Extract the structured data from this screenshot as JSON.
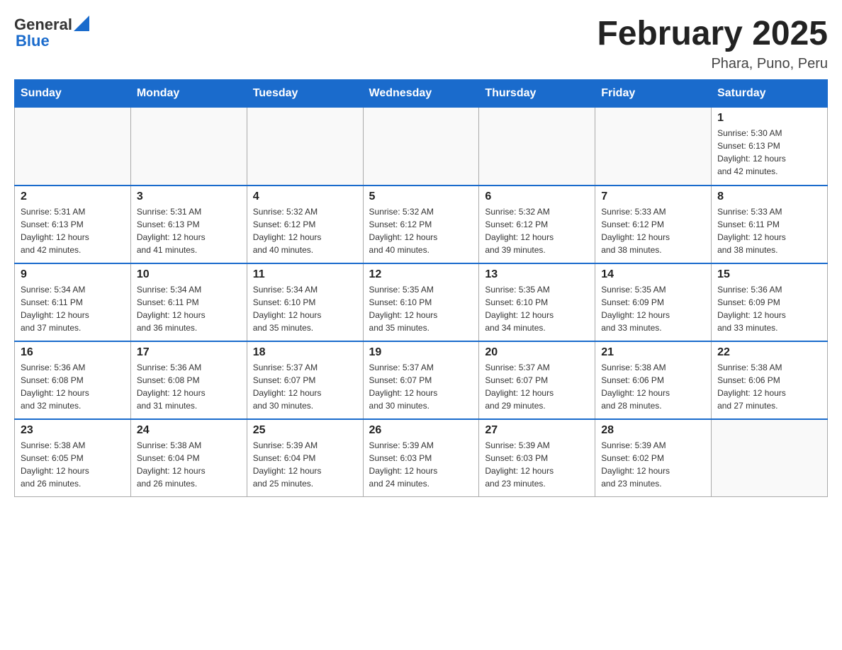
{
  "header": {
    "logo": {
      "general": "General",
      "blue": "Blue"
    },
    "title": "February 2025",
    "location": "Phara, Puno, Peru"
  },
  "days_of_week": [
    "Sunday",
    "Monday",
    "Tuesday",
    "Wednesday",
    "Thursday",
    "Friday",
    "Saturday"
  ],
  "weeks": [
    [
      {
        "day": "",
        "info": ""
      },
      {
        "day": "",
        "info": ""
      },
      {
        "day": "",
        "info": ""
      },
      {
        "day": "",
        "info": ""
      },
      {
        "day": "",
        "info": ""
      },
      {
        "day": "",
        "info": ""
      },
      {
        "day": "1",
        "info": "Sunrise: 5:30 AM\nSunset: 6:13 PM\nDaylight: 12 hours\nand 42 minutes."
      }
    ],
    [
      {
        "day": "2",
        "info": "Sunrise: 5:31 AM\nSunset: 6:13 PM\nDaylight: 12 hours\nand 42 minutes."
      },
      {
        "day": "3",
        "info": "Sunrise: 5:31 AM\nSunset: 6:13 PM\nDaylight: 12 hours\nand 41 minutes."
      },
      {
        "day": "4",
        "info": "Sunrise: 5:32 AM\nSunset: 6:12 PM\nDaylight: 12 hours\nand 40 minutes."
      },
      {
        "day": "5",
        "info": "Sunrise: 5:32 AM\nSunset: 6:12 PM\nDaylight: 12 hours\nand 40 minutes."
      },
      {
        "day": "6",
        "info": "Sunrise: 5:32 AM\nSunset: 6:12 PM\nDaylight: 12 hours\nand 39 minutes."
      },
      {
        "day": "7",
        "info": "Sunrise: 5:33 AM\nSunset: 6:12 PM\nDaylight: 12 hours\nand 38 minutes."
      },
      {
        "day": "8",
        "info": "Sunrise: 5:33 AM\nSunset: 6:11 PM\nDaylight: 12 hours\nand 38 minutes."
      }
    ],
    [
      {
        "day": "9",
        "info": "Sunrise: 5:34 AM\nSunset: 6:11 PM\nDaylight: 12 hours\nand 37 minutes."
      },
      {
        "day": "10",
        "info": "Sunrise: 5:34 AM\nSunset: 6:11 PM\nDaylight: 12 hours\nand 36 minutes."
      },
      {
        "day": "11",
        "info": "Sunrise: 5:34 AM\nSunset: 6:10 PM\nDaylight: 12 hours\nand 35 minutes."
      },
      {
        "day": "12",
        "info": "Sunrise: 5:35 AM\nSunset: 6:10 PM\nDaylight: 12 hours\nand 35 minutes."
      },
      {
        "day": "13",
        "info": "Sunrise: 5:35 AM\nSunset: 6:10 PM\nDaylight: 12 hours\nand 34 minutes."
      },
      {
        "day": "14",
        "info": "Sunrise: 5:35 AM\nSunset: 6:09 PM\nDaylight: 12 hours\nand 33 minutes."
      },
      {
        "day": "15",
        "info": "Sunrise: 5:36 AM\nSunset: 6:09 PM\nDaylight: 12 hours\nand 33 minutes."
      }
    ],
    [
      {
        "day": "16",
        "info": "Sunrise: 5:36 AM\nSunset: 6:08 PM\nDaylight: 12 hours\nand 32 minutes."
      },
      {
        "day": "17",
        "info": "Sunrise: 5:36 AM\nSunset: 6:08 PM\nDaylight: 12 hours\nand 31 minutes."
      },
      {
        "day": "18",
        "info": "Sunrise: 5:37 AM\nSunset: 6:07 PM\nDaylight: 12 hours\nand 30 minutes."
      },
      {
        "day": "19",
        "info": "Sunrise: 5:37 AM\nSunset: 6:07 PM\nDaylight: 12 hours\nand 30 minutes."
      },
      {
        "day": "20",
        "info": "Sunrise: 5:37 AM\nSunset: 6:07 PM\nDaylight: 12 hours\nand 29 minutes."
      },
      {
        "day": "21",
        "info": "Sunrise: 5:38 AM\nSunset: 6:06 PM\nDaylight: 12 hours\nand 28 minutes."
      },
      {
        "day": "22",
        "info": "Sunrise: 5:38 AM\nSunset: 6:06 PM\nDaylight: 12 hours\nand 27 minutes."
      }
    ],
    [
      {
        "day": "23",
        "info": "Sunrise: 5:38 AM\nSunset: 6:05 PM\nDaylight: 12 hours\nand 26 minutes."
      },
      {
        "day": "24",
        "info": "Sunrise: 5:38 AM\nSunset: 6:04 PM\nDaylight: 12 hours\nand 26 minutes."
      },
      {
        "day": "25",
        "info": "Sunrise: 5:39 AM\nSunset: 6:04 PM\nDaylight: 12 hours\nand 25 minutes."
      },
      {
        "day": "26",
        "info": "Sunrise: 5:39 AM\nSunset: 6:03 PM\nDaylight: 12 hours\nand 24 minutes."
      },
      {
        "day": "27",
        "info": "Sunrise: 5:39 AM\nSunset: 6:03 PM\nDaylight: 12 hours\nand 23 minutes."
      },
      {
        "day": "28",
        "info": "Sunrise: 5:39 AM\nSunset: 6:02 PM\nDaylight: 12 hours\nand 23 minutes."
      },
      {
        "day": "",
        "info": ""
      }
    ]
  ]
}
